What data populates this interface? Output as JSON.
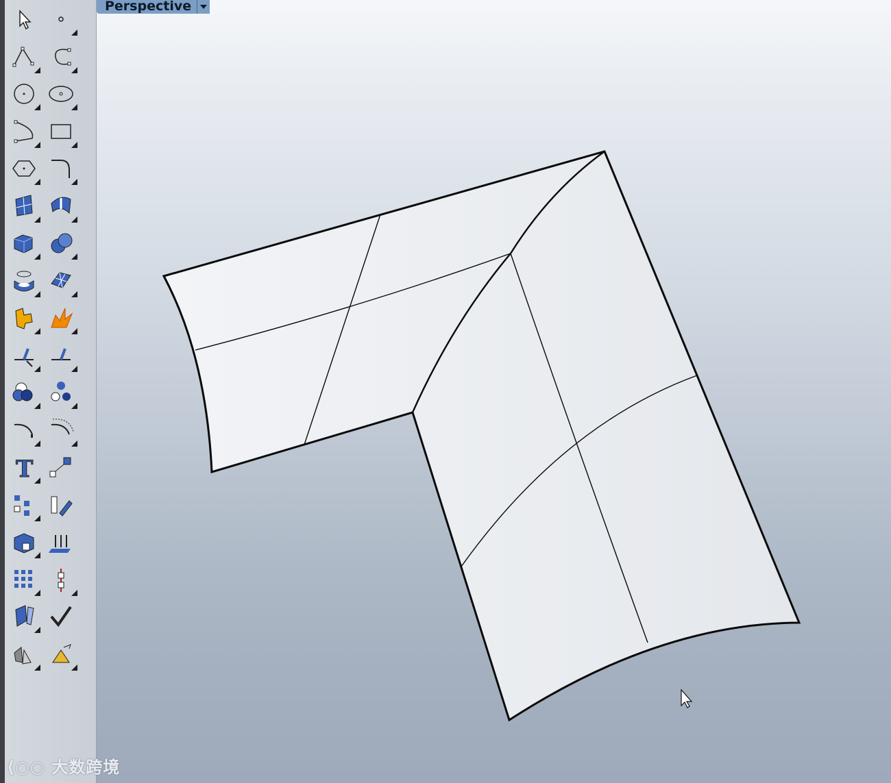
{
  "viewport": {
    "title": "Perspective"
  },
  "toolbar": {
    "tools": [
      {
        "icon": "select-arrow-icon"
      },
      {
        "icon": "point-icon"
      },
      {
        "icon": "polyline-icon"
      },
      {
        "icon": "curve-icon"
      },
      {
        "icon": "circle-icon"
      },
      {
        "icon": "ellipse-icon"
      },
      {
        "icon": "arc-icon"
      },
      {
        "icon": "rectangle-icon"
      },
      {
        "icon": "polygon-icon"
      },
      {
        "icon": "fillet-curve-icon"
      },
      {
        "icon": "surface-from-points-icon"
      },
      {
        "icon": "surface-tools-icon"
      },
      {
        "icon": "box-icon"
      },
      {
        "icon": "solid-tools-icon"
      },
      {
        "icon": "cylinder-icon"
      },
      {
        "icon": "mesh-icon"
      },
      {
        "icon": "join-icon"
      },
      {
        "icon": "explode-icon"
      },
      {
        "icon": "trim-icon"
      },
      {
        "icon": "split-icon"
      },
      {
        "icon": "boolean-union-icon"
      },
      {
        "icon": "group-icon"
      },
      {
        "icon": "fillet-icon"
      },
      {
        "icon": "offset-curve-icon"
      },
      {
        "icon": "text-icon"
      },
      {
        "icon": "scale-icon"
      },
      {
        "icon": "array-icon"
      },
      {
        "icon": "orient-icon"
      },
      {
        "icon": "block-icon"
      },
      {
        "icon": "extrude-icon"
      },
      {
        "icon": "grid-array-icon"
      },
      {
        "icon": "dimension-icon"
      },
      {
        "icon": "analyze-icon"
      },
      {
        "icon": "check-icon"
      },
      {
        "icon": "render-icon"
      },
      {
        "icon": "render-tools-icon"
      }
    ]
  },
  "watermark": {
    "text": "大数跨境"
  },
  "colors": {
    "icon_blue": "#3a62b8",
    "title_bar": "#7c9ec4",
    "surface_edge": "#0a0a0a"
  }
}
